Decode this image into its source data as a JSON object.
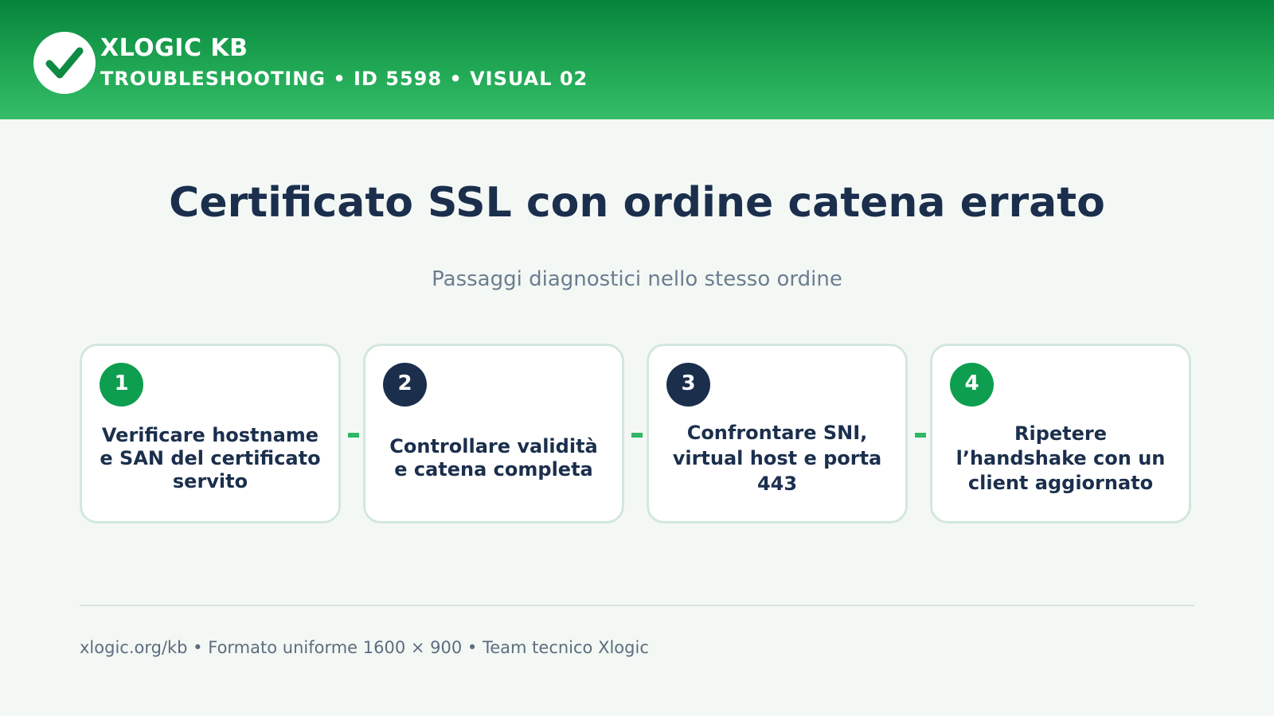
{
  "header": {
    "brand": "XLOGIC KB",
    "subline": "TROUBLESHOOTING • ID 5598 • VISUAL 02",
    "logo_icon": "checkmark-icon",
    "colors": {
      "bar_top": "#06843c",
      "bar_bottom": "#36bd69"
    }
  },
  "main": {
    "title": "Certificato SSL con ordine catena errato",
    "subtitle": "Passaggi diagnostici nello stesso ordine"
  },
  "steps": [
    {
      "number": "1",
      "text": "Verificare hostname e SAN del certificato servito",
      "badge_color": "#0e9e4f"
    },
    {
      "number": "2",
      "text": "Controllare validità e catena completa",
      "badge_color": "#1b2f4d"
    },
    {
      "number": "3",
      "text": "Confrontare SNI, virtual host e porta 443",
      "badge_color": "#1b2f4d"
    },
    {
      "number": "4",
      "text": "Ripetere l’handshake con un client aggiornato",
      "badge_color": "#0e9e4f"
    }
  ],
  "footer": {
    "text": "xlogic.org/kb • Formato uniforme 1600 × 900 • Team tecnico Xlogic"
  }
}
